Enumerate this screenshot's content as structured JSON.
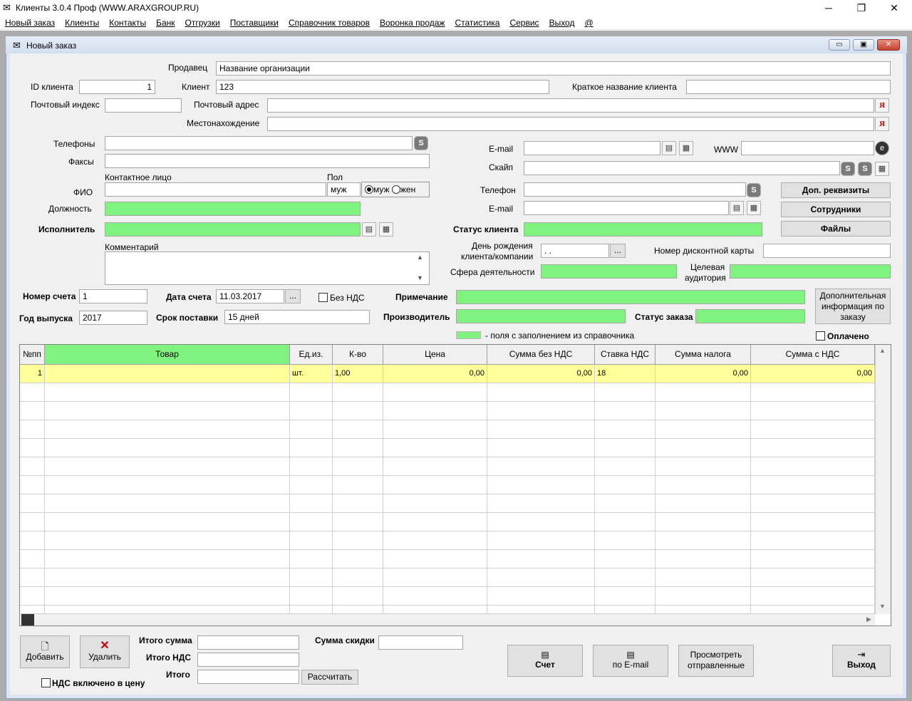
{
  "window": {
    "title": "Клиенты 3.0.4 Проф (WWW.ARAXGROUP.RU)",
    "min": "─",
    "max": "❐",
    "close": "✕"
  },
  "menu": [
    "Новый заказ",
    "Клиенты",
    "Контакты",
    "Банк",
    "Отгрузки",
    "Поставщики",
    "Справочник товаров",
    "Воронка продаж",
    "Статистика",
    "Сервис",
    "Выход",
    "@"
  ],
  "child_window": {
    "title": "Новый заказ"
  },
  "client": {
    "seller_label": "Продавец",
    "seller": "Название организации",
    "id_label": "ID клиента",
    "id": "1",
    "client_label": "Клиент",
    "client": "123",
    "short_name_label": "Краткое название клиента",
    "short_name": "",
    "zip_label": "Почтовый индекс",
    "zip": "",
    "address_label": "Почтовый адрес",
    "address": "",
    "location_label": "Местонахождение",
    "location": "",
    "yandex_icon": "Я",
    "phones_label": "Телефоны",
    "faxes_label": "Факсы",
    "contact_person_label": "Контактное лицо",
    "gender_label": "Пол",
    "fio_label": "ФИО",
    "gender_value": "муж",
    "gender_male": "муж",
    "gender_female": "жен",
    "position_label": "Должность",
    "executor_label": "Исполнитель",
    "comment_label": "Комментарий",
    "email_label": "E-mail",
    "www_label": "WWW",
    "skype_label": "Скайп",
    "phone_label": "Телефон",
    "email2_label": "E-mail",
    "status_label": "Статус клиента",
    "birthday_label_1": "День рождения",
    "birthday_label_2": "клиента/компании",
    "birthday_value": ". .",
    "discount_label": "Номер дисконтной карты",
    "sphere_label": "Сфера деятельности",
    "audience_label_1": "Целевая",
    "audience_label_2": "аудитория",
    "skype_icon": "S"
  },
  "side_buttons": {
    "requisites": "Доп. реквизиты",
    "employees": "Сотрудники",
    "files": "Файлы"
  },
  "order": {
    "invoice_num_label": "Номер счета",
    "invoice_num": "1",
    "invoice_date_label": "Дата счета",
    "invoice_date": "11.03.2017",
    "dots": "...",
    "no_vat_label": "Без НДС",
    "note_label": "Примечание",
    "year_label": "Год выпуска",
    "year": "2017",
    "delivery_label": "Срок поставки",
    "delivery": "15 дней",
    "producer_label": "Производитель",
    "status_label": "Статус заказа",
    "extra_info_1": "Дополнительная",
    "extra_info_2": "информация по",
    "extra_info_3": "заказу",
    "legend": "- поля с заполнением из справочника",
    "paid_label": "Оплачено"
  },
  "table": {
    "columns": [
      "№пп",
      "Товар",
      "Ед.из.",
      "К-во",
      "Цена",
      "Сумма без НДС",
      "Ставка НДС",
      "Сумма налога",
      "Сумма с НДС"
    ],
    "row": [
      "1",
      "",
      "шт.",
      "1,00",
      "0,00",
      "0,00",
      "18",
      "0,00",
      "0,00"
    ]
  },
  "footer": {
    "add": "Добавить",
    "delete": "Удалить",
    "vat_included": "НДС включено в цену",
    "total_sum_label": "Итого сумма",
    "total_vat_label": "Итого НДС",
    "total_label": "Итого",
    "calc": "Рассчитать",
    "discount_label": "Сумма скидки",
    "invoice_btn": "Счет",
    "email_btn": "по E-mail",
    "view_sent_1": "Просмотреть",
    "view_sent_2": "отправленные",
    "exit": "Выход"
  }
}
